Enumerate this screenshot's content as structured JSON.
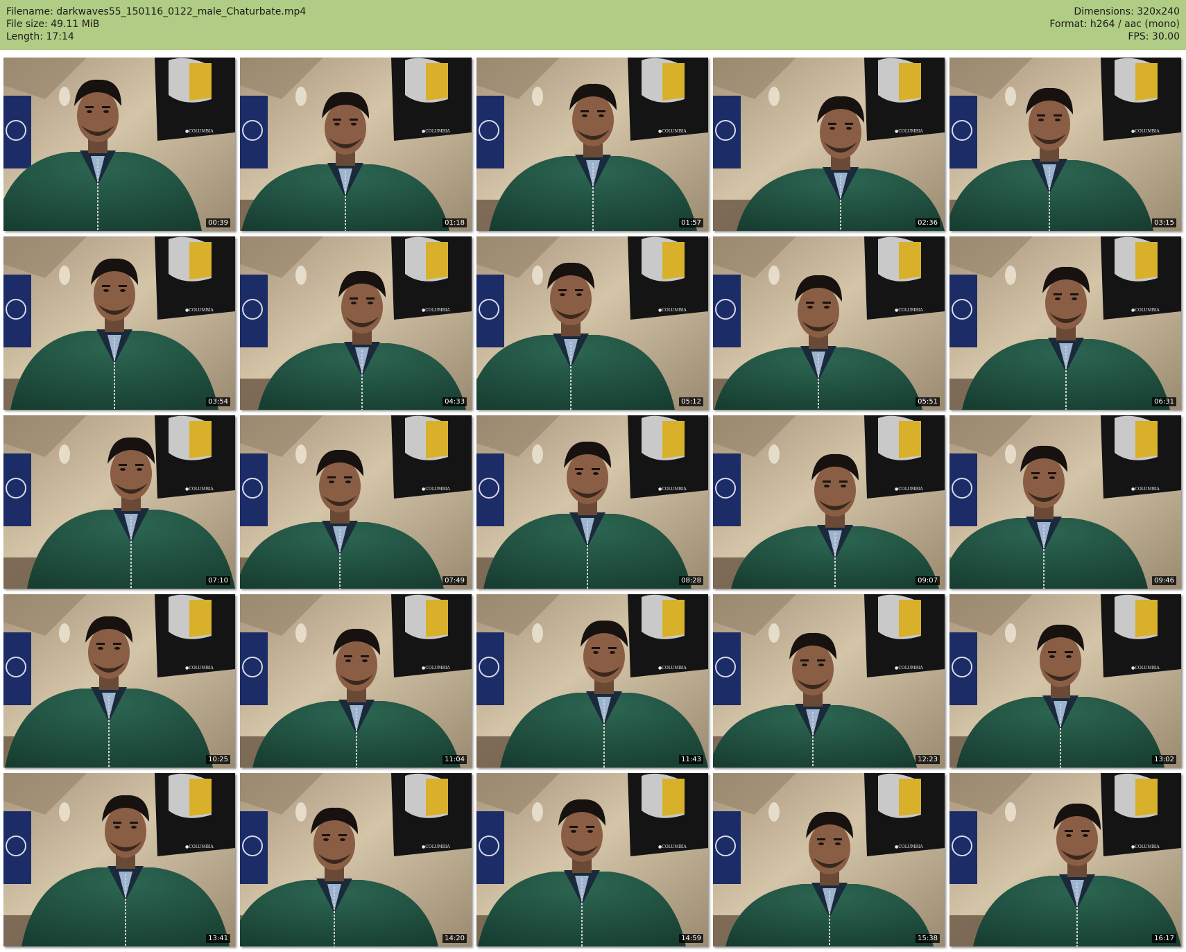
{
  "header": {
    "filename": "Filename: darkwaves55_150116_0122_male_Chaturbate.mp4",
    "filesize": "File size: 49.11 MiB",
    "length": "Length: 17:14",
    "dimensions": "Dimensions: 320x240",
    "format": "Format: h264 / aac (mono)",
    "fps": "FPS: 30.00"
  },
  "colors": {
    "header_bg": "#b1cc84",
    "wall": "#c9b89c",
    "sweater": "#1f4d3c",
    "poster": "#141414",
    "flag": "#1c2c66"
  },
  "thumbnails": [
    {
      "time": "00:39"
    },
    {
      "time": "01:18"
    },
    {
      "time": "01:57"
    },
    {
      "time": "02:36"
    },
    {
      "time": "03:15"
    },
    {
      "time": "03:54"
    },
    {
      "time": "04:33"
    },
    {
      "time": "05:12"
    },
    {
      "time": "05:51"
    },
    {
      "time": "06:31"
    },
    {
      "time": "07:10"
    },
    {
      "time": "07:49"
    },
    {
      "time": "08:28"
    },
    {
      "time": "09:07"
    },
    {
      "time": "09:46"
    },
    {
      "time": "10:25"
    },
    {
      "time": "11:04"
    },
    {
      "time": "11:43"
    },
    {
      "time": "12:23"
    },
    {
      "time": "13:02"
    },
    {
      "time": "13:41"
    },
    {
      "time": "14:20"
    },
    {
      "time": "14:59"
    },
    {
      "time": "15:38"
    },
    {
      "time": "16:17"
    }
  ]
}
